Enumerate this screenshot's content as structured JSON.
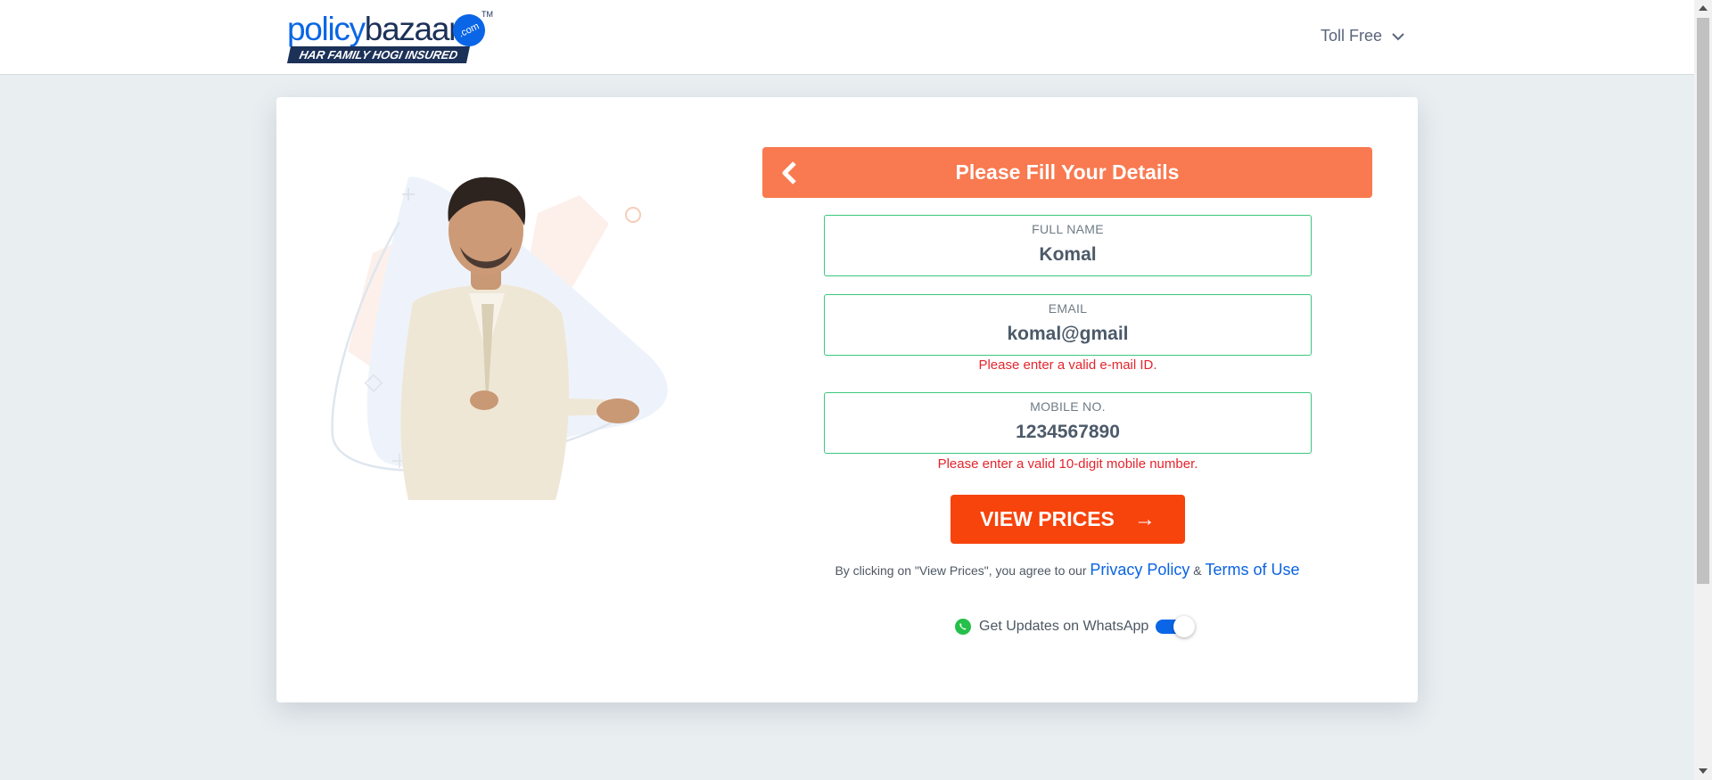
{
  "header": {
    "logo": {
      "brand_part1": "policy",
      "brand_part2": "bazaar",
      "badge": ".com",
      "trademark": "TM",
      "tagline": "HAR FAMILY HOGI INSURED"
    },
    "toll_free_label": "Toll Free",
    "toll_free_icon": "chevron-down-icon"
  },
  "form": {
    "title": "Please Fill Your Details",
    "back_icon": "chevron-left-icon",
    "fields": [
      {
        "label": "FULL NAME",
        "value": "Komal",
        "error": ""
      },
      {
        "label": "EMAIL",
        "value": "komal@gmail",
        "error": "Please enter a valid e-mail ID."
      },
      {
        "label": "MOBILE NO.",
        "value": "1234567890",
        "error": "Please enter a valid 10-digit mobile number."
      }
    ],
    "submit_label": "VIEW PRICES",
    "submit_icon": "arrow-right-icon",
    "consent": {
      "text": "By clicking on \"View Prices\", you agree to our",
      "privacy_link": "Privacy Policy",
      "separator": "&",
      "terms_link": "Terms of Use"
    },
    "whatsapp": {
      "label": "Get Updates on WhatsApp",
      "icon": "whatsapp-icon",
      "enabled": true
    }
  },
  "colors": {
    "brand_blue": "#0a66e6",
    "brand_navy": "#1c3158",
    "header_orange": "#f97950",
    "cta_orange": "#f7430c",
    "field_border_green": "#3bc77e",
    "error_red": "#e4252d"
  }
}
